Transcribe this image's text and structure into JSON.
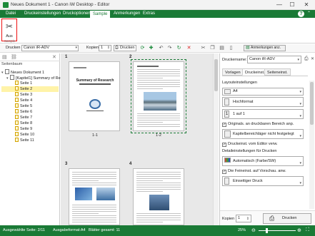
{
  "window": {
    "title": "Neues Dokument 1 - Canon iW Desktop - Editor",
    "controls": [
      "—",
      "☐",
      "✕"
    ]
  },
  "ribbon_tabs": [
    {
      "label": "Datei"
    },
    {
      "label": "Druckeinstellungen"
    },
    {
      "label": "Druckoptionen"
    },
    {
      "label": "Sample"
    },
    {
      "label": "Anmerkungen"
    },
    {
      "label": "Extras"
    }
  ],
  "ribbon": {
    "cut_label": "Aus",
    "group_label": "Sample"
  },
  "toolbar": {
    "printer_label": "Drucken",
    "printer_value": "Canon iR-ADV",
    "copies_label": "Kopien",
    "copies_value": "1",
    "print_button": "Drucken",
    "annotation_button": "Anmerkungen anz."
  },
  "left_panel": {
    "header": "Seitenbaum",
    "tree": [
      {
        "label": "Neues Dokument 1",
        "level": 0,
        "kind": "doc"
      },
      {
        "label": "[Kapitel1] Summary of Re",
        "level": 1,
        "kind": "doc"
      },
      {
        "label": "Seite 1",
        "level": 2,
        "kind": "page"
      },
      {
        "label": "Seite 2",
        "level": 2,
        "kind": "page",
        "selected": true
      },
      {
        "label": "Seite 3",
        "level": 2,
        "kind": "page"
      },
      {
        "label": "Seite 4",
        "level": 2,
        "kind": "page"
      },
      {
        "label": "Seite 5",
        "level": 2,
        "kind": "page"
      },
      {
        "label": "Seite 6",
        "level": 2,
        "kind": "page"
      },
      {
        "label": "Seite 7",
        "level": 2,
        "kind": "page"
      },
      {
        "label": "Seite 8",
        "level": 2,
        "kind": "page"
      },
      {
        "label": "Seite 9",
        "level": 2,
        "kind": "page"
      },
      {
        "label": "Seite 10",
        "level": 2,
        "kind": "page"
      },
      {
        "label": "Seite 11",
        "level": 2,
        "kind": "page"
      }
    ]
  },
  "pages": [
    {
      "number": "1",
      "label": "1-1",
      "heading": "Summary of Research"
    },
    {
      "number": "2",
      "label": "1-2",
      "heading": "Introduction"
    },
    {
      "number": "3",
      "label": "",
      "heading": ""
    },
    {
      "number": "4",
      "label": "",
      "heading": ""
    }
  ],
  "right_panel": {
    "printer_name_label": "Druckername:",
    "printer_name_value": "Canon iR-ADV",
    "tabs": [
      "Vorlagen",
      "Druckeinst.",
      "Seiteneinst."
    ],
    "layout_heading": "Layouteinstellungen",
    "paper_size": "A4",
    "orientation": "Hochformat",
    "pages_per_sheet": "1 auf 1",
    "chk_original": "Originals. an druckbaren Bereich anp.",
    "edge_setting": "Kapitelbereichläger nicht festgelegt",
    "chk_editor": "Druckeinst. vom Editor verw.",
    "detail_heading": "Detaileinstellungen für Drucken",
    "color_mode": "Automatisch (Farbe/SW)",
    "chk_fineset": "Die Feineinst. auf Vorschau. anw.",
    "duplex": "Einseitiger Druck",
    "copies_label": "Kopien",
    "copies_value": "1",
    "print_button": "Drucken"
  },
  "status_bar": {
    "selected_pages": "Ausgewählte Seite: 2/11",
    "paper_format": "Ausgabeformat:A4",
    "sheets_total": "Blätter gesamt: 11",
    "zoom": "25%"
  }
}
